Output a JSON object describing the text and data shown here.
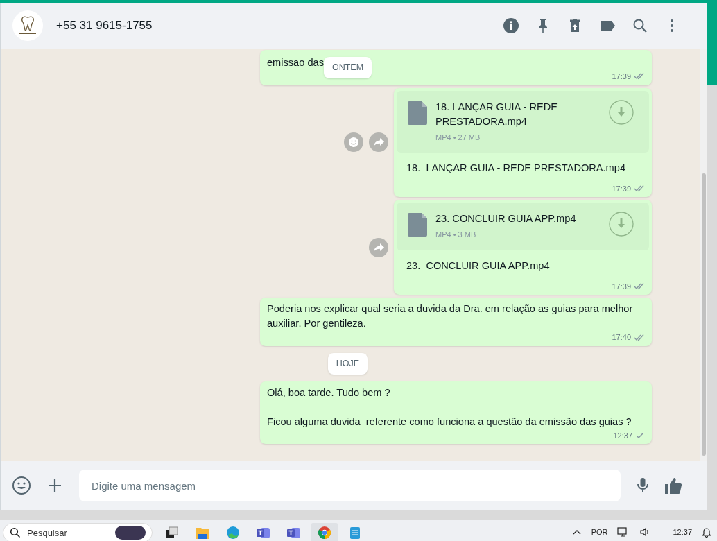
{
  "chat_header": {
    "contact": "+55 31 9615-1755"
  },
  "sticky_date": "ONTEM",
  "messages": [
    {
      "kind": "text",
      "text": "emissao das",
      "time": "17:39",
      "double_tick": true
    },
    {
      "kind": "document",
      "file_name": "18. LANÇAR GUIA - REDE PRESTADORA.mp4",
      "meta": "MP4 • 27 MB",
      "caption": "18.  LANÇAR GUIA - REDE PRESTADORA.mp4",
      "time": "17:39",
      "double_tick": true,
      "hover_actions": true
    },
    {
      "kind": "document",
      "file_name": "23. CONCLUIR GUIA APP.mp4",
      "meta": "MP4 • 3 MB",
      "caption": "23.  CONCLUIR GUIA APP.mp4",
      "time": "17:39",
      "double_tick": true,
      "hover_actions": false
    },
    {
      "kind": "text",
      "text": "Poderia nos explicar qual seria a duvida da Dra. em relação as guias para melhor auxiliar. Por gentileza.",
      "time": "17:40",
      "double_tick": true
    },
    {
      "kind": "date",
      "text": "HOJE"
    },
    {
      "kind": "text",
      "text": "Olá, boa tarde. Tudo bem ?\n\nFicou alguma duvida  referente como funciona a questão da emissão das guias ?",
      "time": "12:37",
      "double_tick": false
    }
  ],
  "composer": {
    "placeholder": "Digite uma mensagem"
  },
  "taskbar": {
    "search_placeholder": "Pesquisar",
    "apps": [
      {
        "kind": "taskview",
        "selected": false
      },
      {
        "kind": "folder",
        "selected": false
      },
      {
        "kind": "edge",
        "selected": false
      },
      {
        "kind": "teams",
        "selected": false
      },
      {
        "kind": "teams",
        "selected": false
      },
      {
        "kind": "chrome",
        "selected": true
      },
      {
        "kind": "notepad",
        "selected": false
      }
    ],
    "language": "POR",
    "clock": "12:37"
  }
}
